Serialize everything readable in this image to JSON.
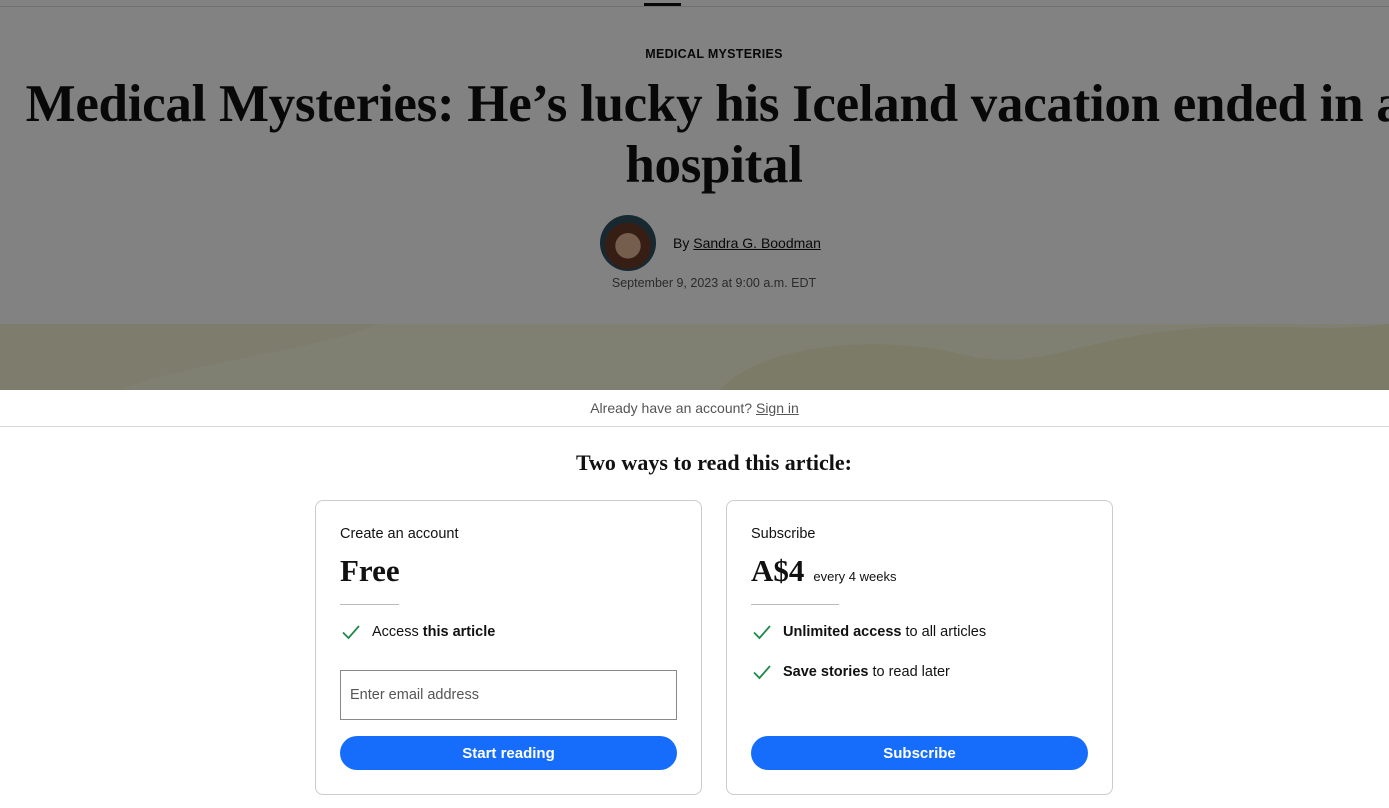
{
  "article": {
    "kicker": "MEDICAL MYSTERIES",
    "headline": "Medical Mysteries: He’s lucky his Iceland vacation ended in a hospital",
    "byline_prefix": "By",
    "author": "Sandra G. Boodman",
    "date": "September 9, 2023 at 9:00 a.m. EDT"
  },
  "paywall": {
    "signin_prompt": "Already have an account?",
    "signin_link": "Sign in",
    "title": "Two ways to read this article:",
    "account_card": {
      "label": "Create an account",
      "price": "Free",
      "benefits": [
        {
          "text": "Access",
          "bold": "this article"
        }
      ],
      "email_placeholder": "Enter email address",
      "button": "Start reading"
    },
    "subscribe_card": {
      "label": "Subscribe",
      "price": "A$4",
      "price_note": "every 4 weeks",
      "benefits": [
        {
          "bold": "Unlimited access",
          "text": "to all articles"
        },
        {
          "bold": "Save stories",
          "text": "to read later"
        }
      ],
      "button": "Subscribe"
    }
  },
  "colors": {
    "cta_blue": "#166dfc",
    "check_green": "#1e8a4c",
    "overlay": "rgba(0,0,0,0.49)"
  },
  "icons": [
    "checkmark-icon",
    "author-avatar"
  ]
}
